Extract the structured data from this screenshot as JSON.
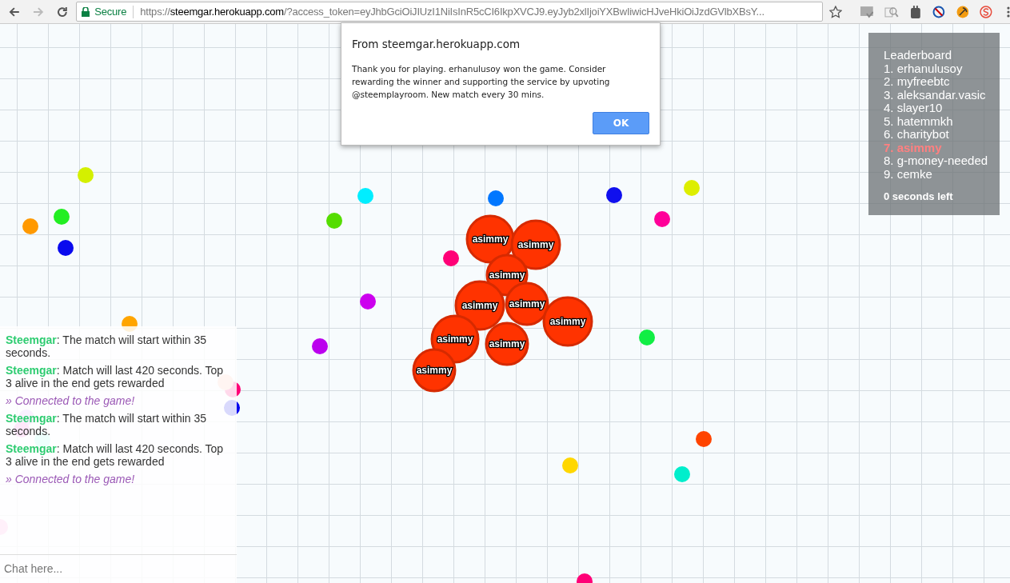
{
  "browser": {
    "security_label": "Secure",
    "url": {
      "scheme": "https://",
      "host": "steemgar.herokuapp.com",
      "path": "/?access_token=eyJhbGciOiJIUzI1NiIsInR5cCI6IkpXVCJ9.eyJyb2xlIjoiYXBwIiwicHJveHkiOiJzdGVlbXBsY..."
    }
  },
  "dialog": {
    "title": "From steemgar.herokuapp.com",
    "message": "Thank you for playing. erhanulusoy won the game. Consider rewarding the winner and supporting the service by upvoting @steemplayroom. New match every 30 mins.",
    "button": "OK"
  },
  "leaderboard": {
    "title": "Leaderboard",
    "entries": [
      {
        "label": "1. erhanulusoy",
        "selected": false
      },
      {
        "label": "2. myfreebtc",
        "selected": false
      },
      {
        "label": "3. aleksandar.vasic",
        "selected": false
      },
      {
        "label": "4. slayer10",
        "selected": false
      },
      {
        "label": "5. hatemmkh",
        "selected": false
      },
      {
        "label": "6. charitybot",
        "selected": false
      },
      {
        "label": "7. asimmy",
        "selected": true
      },
      {
        "label": "8. g-money-needed",
        "selected": false
      },
      {
        "label": "9. cemke",
        "selected": false
      }
    ],
    "timer": "0 seconds left"
  },
  "cells": [
    "asimmy",
    "asimmy",
    "asimmy",
    "asimmy",
    "asimmy",
    "asimmy",
    "asimmy",
    "asimmy",
    "asimmy"
  ],
  "chat": {
    "messages": [
      {
        "kind": "server",
        "sender": "Steemgar",
        "text": ": The match will start within 35 seconds."
      },
      {
        "kind": "server",
        "sender": "Steemgar",
        "text": ": Match will last 420 seconds. Top 3 alive in the end gets rewarded"
      },
      {
        "kind": "notice",
        "text": "» Connected to the game!"
      },
      {
        "kind": "server",
        "sender": "Steemgar",
        "text": ": The match will start within 35 seconds."
      },
      {
        "kind": "server",
        "sender": "Steemgar",
        "text": ": Match will last 420 seconds. Top 3 alive in the end gets rewarded"
      },
      {
        "kind": "notice",
        "text": "» Connected to the game!"
      }
    ],
    "placeholder": "Chat here..."
  }
}
